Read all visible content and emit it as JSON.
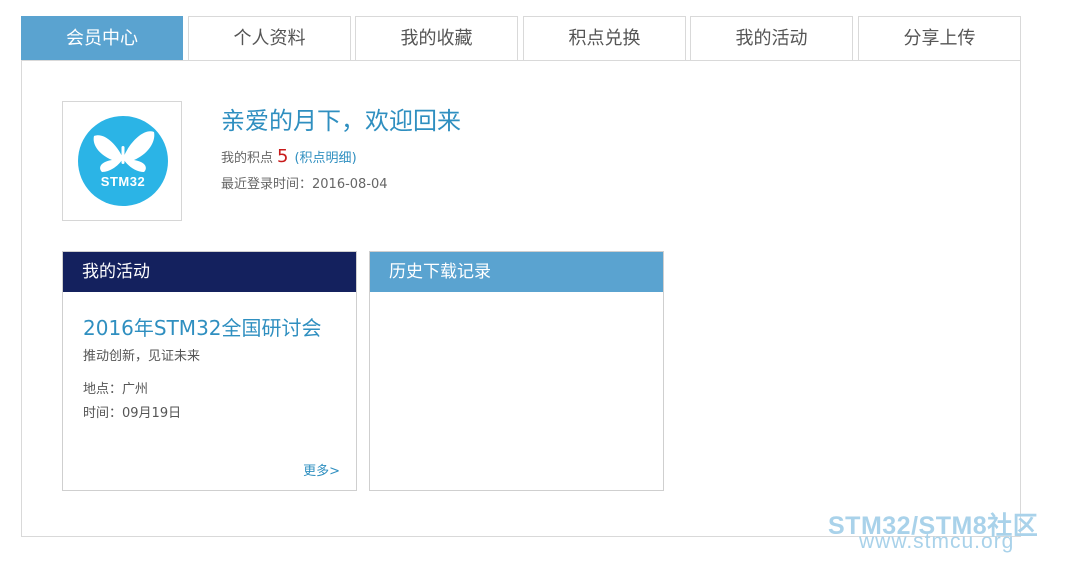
{
  "tabs": [
    {
      "label": "会员中心",
      "active": true
    },
    {
      "label": "个人资料",
      "active": false
    },
    {
      "label": "我的收藏",
      "active": false
    },
    {
      "label": "积点兑换",
      "active": false
    },
    {
      "label": "我的活动",
      "active": false
    },
    {
      "label": "分享上传",
      "active": false
    }
  ],
  "profile": {
    "avatar_text": "STM32",
    "welcome": "亲爱的月下，欢迎回来",
    "points_label": "我的积点",
    "points_value": "5",
    "points_detail_link": "积点明细",
    "last_login_label": "最近登录时间：",
    "last_login_value": "2016-08-04"
  },
  "activity_card": {
    "title": "我的活动",
    "event_title": "2016年STM32全国研讨会",
    "event_subtitle": "推动创新，见证未来",
    "location": "地点：广州",
    "time": "时间：09月19日",
    "more_link": "更多>"
  },
  "history_card": {
    "title": "历史下载记录"
  },
  "watermark": {
    "line1": "STM32/STM8社区",
    "line2": "www.stmcu.org"
  },
  "colors": {
    "accent": "#5aa3d0",
    "link": "#2f8fc0",
    "dark_header": "#14215e",
    "points_red": "#c81b1b",
    "avatar_blue": "#2bb4e6"
  },
  "icons": {
    "avatar": "stm32-butterfly-logo"
  }
}
